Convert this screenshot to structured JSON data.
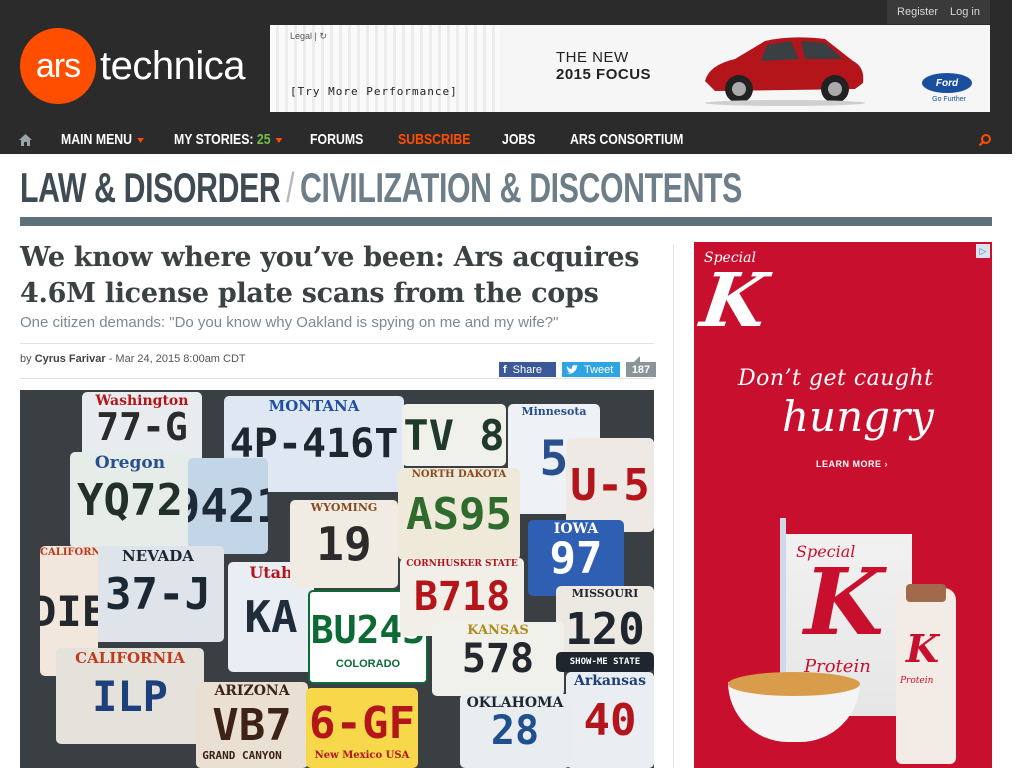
{
  "userbar": {
    "register": "Register",
    "login": "Log in"
  },
  "logo": {
    "ars": "ars",
    "technica": "technica"
  },
  "top_ad": {
    "legal": "Legal",
    "cta": "[Try More Performance]",
    "headline_line1": "THE NEW",
    "headline_line2": "2015 FOCUS",
    "brand": "Ford",
    "brand_tagline": "Go Further"
  },
  "nav": {
    "items": [
      {
        "label": "MAIN MENU"
      },
      {
        "label": "MY STORIES:",
        "count": "25"
      },
      {
        "label": "FORUMS"
      },
      {
        "label": "SUBSCRIBE"
      },
      {
        "label": "JOBS"
      },
      {
        "label": "ARS CONSORTIUM"
      }
    ],
    "accent": "#ff4e00",
    "count_color": "#6cc04a"
  },
  "section": {
    "primary": "LAW & DISORDER",
    "separator": "/",
    "secondary": "CIVILIZATION & DISCONTENTS"
  },
  "article": {
    "title": "We know where you’ve been: Ars acquires 4.6M license plate scans from the cops",
    "subtitle": "One citizen demands: \"Do you know why Oakland is spying on me and my wife?\"",
    "byline_prefix": "by",
    "author": "Cyrus Farivar",
    "dateline": "- Mar 24, 2015 8:00am CDT",
    "share_label": "Share",
    "tweet_label": "Tweet",
    "comment_count": "187"
  },
  "photo": {
    "plates": [
      {
        "state": "Washington",
        "text": "77-G"
      },
      {
        "state": "MONTANA",
        "text": "4P-416T"
      },
      {
        "state": "",
        "text": "TV 8"
      },
      {
        "state": "Minnesota",
        "text": "5"
      },
      {
        "state": "Oregon",
        "text": "YQ72"
      },
      {
        "state": "",
        "text": "9421"
      },
      {
        "state": "NORTH DAKOTA",
        "text": "AS95"
      },
      {
        "state": "",
        "text": "U-5"
      },
      {
        "state": "NEVADA",
        "text": "37-J"
      },
      {
        "state": "Utah",
        "text": "KA"
      },
      {
        "state": "WYOMING",
        "text": "19"
      },
      {
        "state": "IOWA",
        "text": "97"
      },
      {
        "state": "CALIFORNIA",
        "text": "DIE"
      },
      {
        "state": "COLORADO",
        "text": "BU243"
      },
      {
        "state": "CORNHUSKER STATE",
        "text": "B718"
      },
      {
        "state": "MISSOURI",
        "text": "120"
      },
      {
        "state": "CALIFORNIA",
        "text": "ILP"
      },
      {
        "state": "ARIZONA",
        "text": "VB7"
      },
      {
        "state": "KANSAS",
        "text": "578"
      },
      {
        "state": "Arkansas",
        "text": "40"
      },
      {
        "state": "New Mexico USA",
        "text": "6-GF"
      },
      {
        "state": "OKLAHOMA",
        "text": "28"
      },
      {
        "state": "GRAND CANYON",
        "text": ""
      },
      {
        "state": "SHOW-ME STATE",
        "text": ""
      }
    ]
  },
  "side_ad": {
    "brand_word": "Special",
    "brand_letter": "K",
    "line1": "Don’t get caught",
    "line2": "hungry",
    "cta": "LEARN MORE ›",
    "box_brand": "Special",
    "box_letter": "K",
    "box_flavor": "Protein",
    "bottle_letter": "K",
    "bottle_label": "Protein",
    "bg_color": "#c8102e"
  }
}
